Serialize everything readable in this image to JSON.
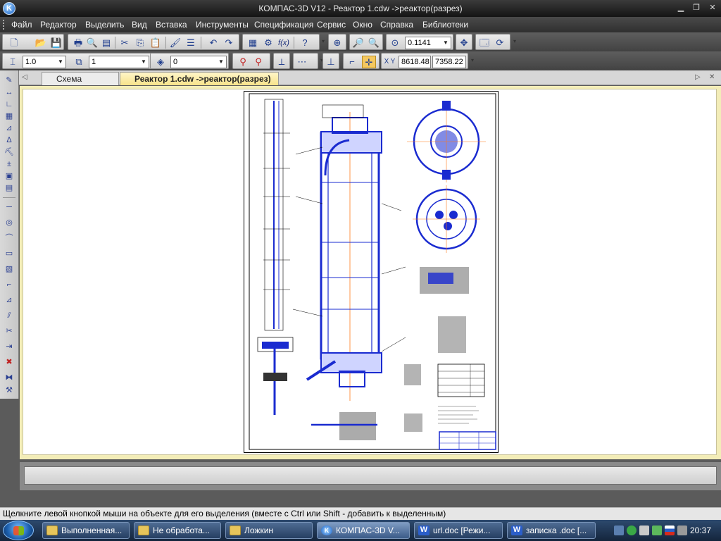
{
  "window": {
    "title": "КОМПАС-3D V12 - Реактор  1.cdw ->реактор(разрез)",
    "app_icon_letter": "K"
  },
  "menu": [
    "Файл",
    "Редактор",
    "Выделить",
    "Вид",
    "Вставка",
    "Инструменты",
    "Спецификация",
    "Сервис",
    "Окно",
    "Справка",
    "Библиотеки"
  ],
  "toolbar1": {
    "fx_label": "f(x)",
    "zoom_value": "0.1141"
  },
  "toolbar2": {
    "line_style_value": "1.0",
    "layer_value": "1",
    "layer_state_value": "0",
    "x_label": "X",
    "y_label": "Y",
    "coord_x": "8618.48",
    "coord_y": "7358.22"
  },
  "tabs": [
    {
      "label": "Схема испр.frw",
      "active": false
    },
    {
      "label": "Реактор  1.cdw ->реактор(разрез)",
      "active": true
    }
  ],
  "status": {
    "hint": "Щелкните левой кнопкой мыши на объекте для его выделения (вместе с Ctrl или Shift - добавить к выделенным)"
  },
  "taskbar": {
    "tasks": [
      {
        "label": "Выполненная...",
        "icon": "folder-icon"
      },
      {
        "label": "Не обработа...",
        "icon": "folder-icon"
      },
      {
        "label": "Ложкин",
        "icon": "folder-icon"
      },
      {
        "label": "КОМПАС-3D V...",
        "icon": "kompas-icon",
        "active": true
      },
      {
        "label": "url.doc [Режи...",
        "icon": "word-icon"
      },
      {
        "label": "записка .doc [...",
        "icon": "word-icon"
      }
    ],
    "word_letter": "W",
    "clock": "20:37"
  }
}
